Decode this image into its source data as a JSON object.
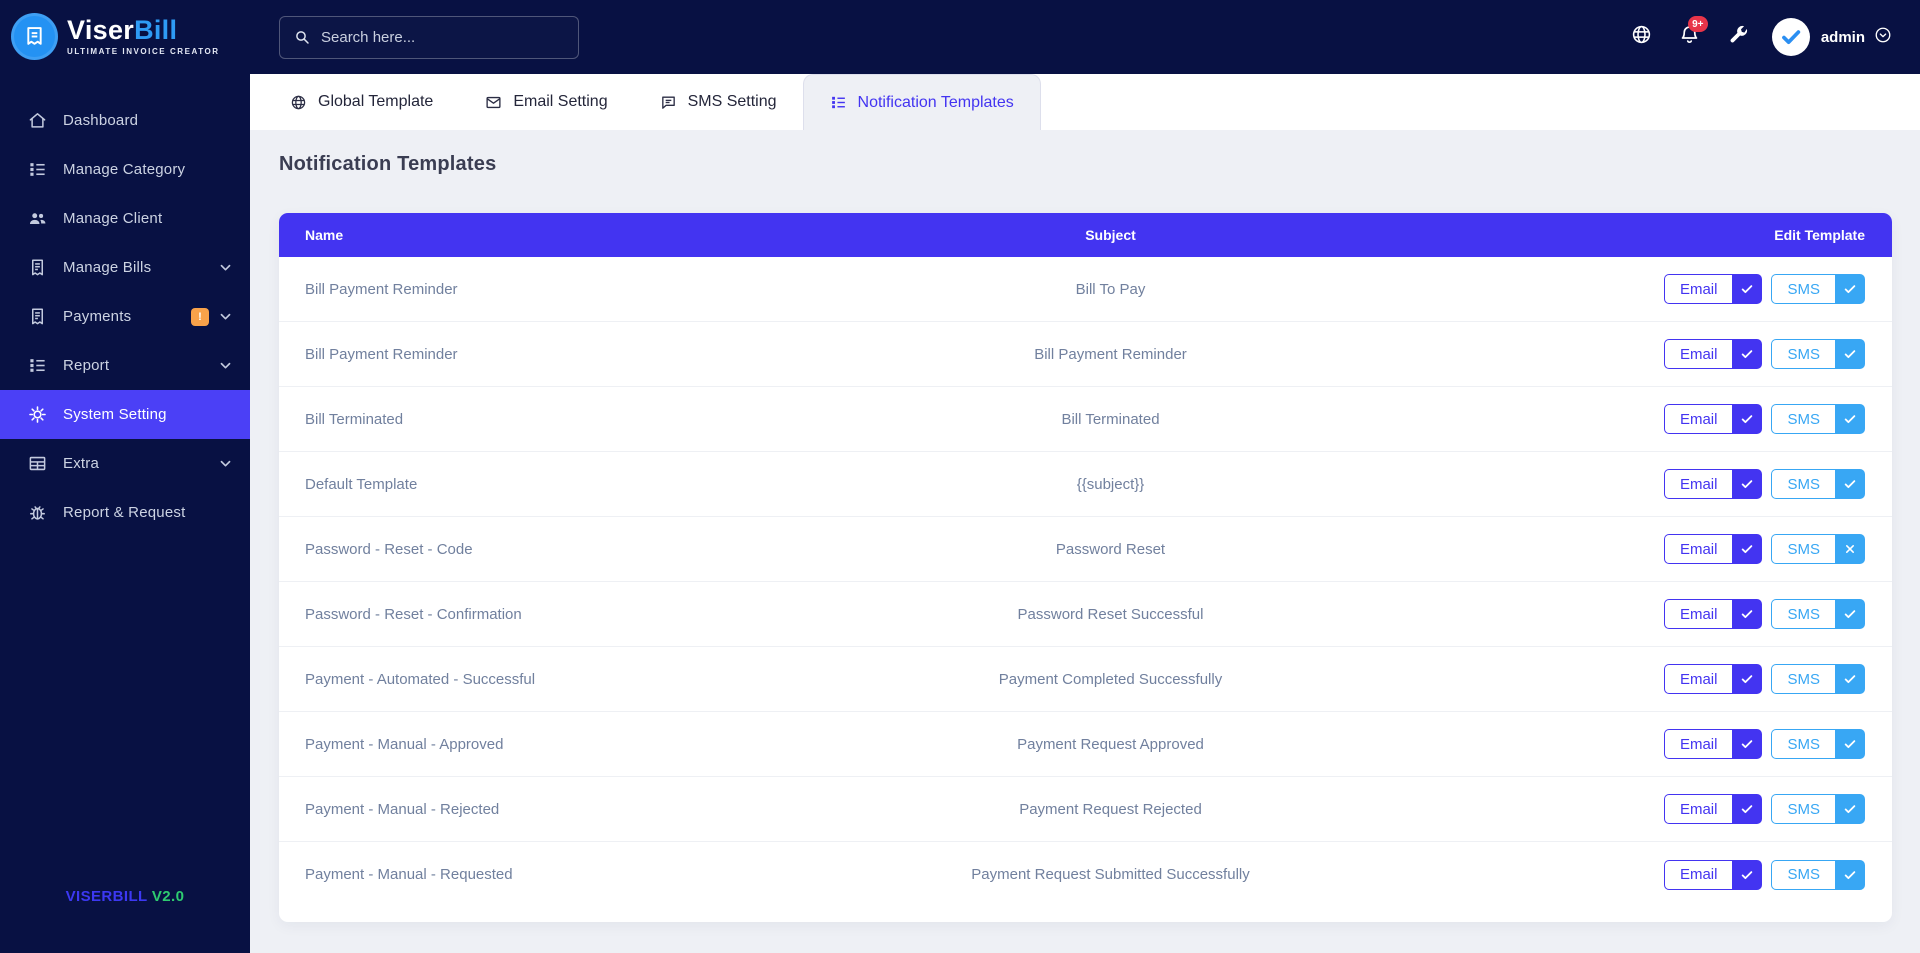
{
  "brand": {
    "logo_icon": "receipt-icon",
    "name_primary": "Viser",
    "name_secondary": "Bill",
    "tagline": "ULTIMATE INVOICE CREATOR"
  },
  "sidebar": {
    "items": [
      {
        "label": "Dashboard",
        "icon": "home-icon",
        "chevron": false,
        "active": false
      },
      {
        "label": "Manage Category",
        "icon": "list-icon",
        "chevron": false,
        "active": false
      },
      {
        "label": "Manage Client",
        "icon": "users-icon",
        "chevron": false,
        "active": false
      },
      {
        "label": "Manage Bills",
        "icon": "invoice-icon",
        "chevron": true,
        "active": false
      },
      {
        "label": "Payments",
        "icon": "invoice-icon",
        "chevron": true,
        "active": false,
        "badge": "!"
      },
      {
        "label": "Report",
        "icon": "list-icon",
        "chevron": true,
        "active": false
      },
      {
        "label": "System Setting",
        "icon": "gear-icon",
        "chevron": false,
        "active": true
      },
      {
        "label": "Extra",
        "icon": "table-icon",
        "chevron": true,
        "active": false
      },
      {
        "label": "Report & Request",
        "icon": "bug-icon",
        "chevron": false,
        "active": false
      }
    ],
    "version_brand": "VISERBILL",
    "version_number": "V2.0"
  },
  "topbar": {
    "search_placeholder": "Search here...",
    "notification_badge": "9+",
    "username": "admin",
    "icons": [
      "globe-icon",
      "bell-icon",
      "wrench-icon",
      "avatar-check-logo",
      "chevron-down-circle-icon"
    ]
  },
  "tabs": [
    {
      "label": "Global Template",
      "icon": "globe-icon",
      "active": false
    },
    {
      "label": "Email Setting",
      "icon": "envelope-icon",
      "active": false
    },
    {
      "label": "SMS Setting",
      "icon": "chat-icon",
      "active": false
    },
    {
      "label": "Notification Templates",
      "icon": "list-icon",
      "active": true
    }
  ],
  "page": {
    "title": "Notification Templates"
  },
  "table": {
    "columns": [
      "Name",
      "Subject",
      "Edit Template"
    ],
    "email_button": "Email",
    "sms_button": "SMS",
    "rows": [
      {
        "name": "Bill Payment Reminder",
        "subject": "Bill To Pay",
        "email": true,
        "sms": true
      },
      {
        "name": "Bill Payment Reminder",
        "subject": "Bill Payment Reminder",
        "email": true,
        "sms": true
      },
      {
        "name": "Bill Terminated",
        "subject": "Bill Terminated",
        "email": true,
        "sms": true
      },
      {
        "name": "Default Template",
        "subject": "{{subject}}",
        "email": true,
        "sms": true
      },
      {
        "name": "Password - Reset - Code",
        "subject": "Password Reset",
        "email": true,
        "sms": false
      },
      {
        "name": "Password - Reset - Confirmation",
        "subject": "Password Reset Successful",
        "email": true,
        "sms": true
      },
      {
        "name": "Payment - Automated - Successful",
        "subject": "Payment Completed Successfully",
        "email": true,
        "sms": true
      },
      {
        "name": "Payment - Manual - Approved",
        "subject": "Payment Request Approved",
        "email": true,
        "sms": true
      },
      {
        "name": "Payment - Manual - Rejected",
        "subject": "Payment Request Rejected",
        "email": true,
        "sms": true
      },
      {
        "name": "Payment - Manual - Requested",
        "subject": "Payment Request Submitted Successfully",
        "email": true,
        "sms": true
      }
    ]
  },
  "colors": {
    "navy": "#081143",
    "accent_indigo": "#4334f1",
    "sidebar_active": "#4b40f6",
    "sms_blue": "#38a7f4",
    "badge_orange": "#f8a24a",
    "badge_red": "#e8354a",
    "page_bg": "#eef0f5",
    "row_text": "#71809e",
    "brand_blue": "#2e9bf5",
    "version_green": "#2ecb70"
  }
}
